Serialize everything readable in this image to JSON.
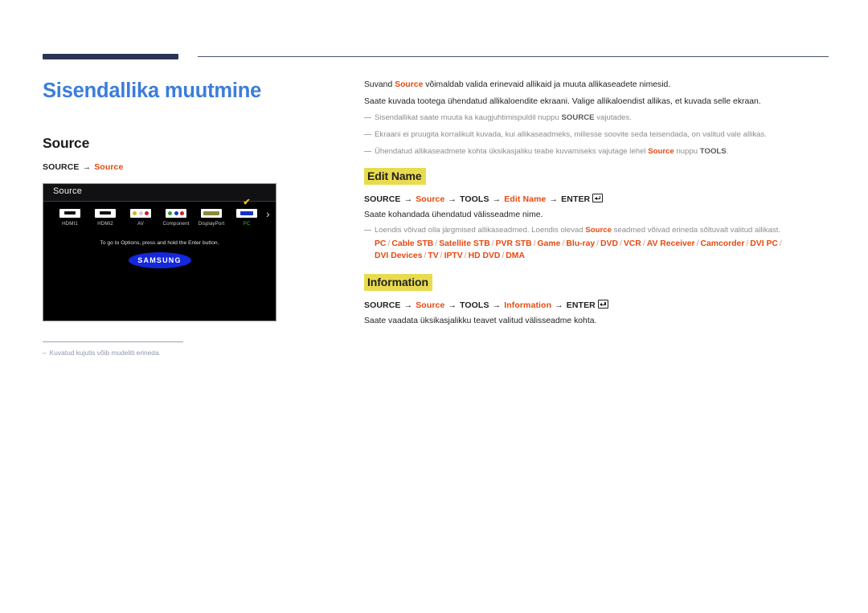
{
  "page": {
    "title": "Sisendallika muutmine",
    "title_color": "#3b7ddb",
    "accent_color": "#e8490f",
    "highlight_color": "#e8dc4e",
    "rule_color": "#2b3553"
  },
  "left": {
    "section_title": "Source",
    "path": {
      "root": "SOURCE",
      "arrow": "→",
      "target": "Source"
    },
    "tv": {
      "screen_title": "Source",
      "hint": "To go to Options, press and hold the Enter button.",
      "brand": "SAMSUNG",
      "next_arrow": "›",
      "check_mark": "✔",
      "sources": [
        {
          "label": "HDMI1",
          "icon": "hdmi-port-icon",
          "selected": false
        },
        {
          "label": "HDMI2",
          "icon": "hdmi-port-icon",
          "selected": false
        },
        {
          "label": "AV",
          "icon": "rca-composite-icon",
          "selected": false
        },
        {
          "label": "Component",
          "icon": "rca-component-icon",
          "selected": false
        },
        {
          "label": "DisplayPort",
          "icon": "displayport-icon",
          "selected": false
        },
        {
          "label": "PC",
          "icon": "vga-port-icon",
          "selected": true
        }
      ]
    },
    "footnote": {
      "dash": "–",
      "text": "Kuvatud kujutis võib mudeliti erineda."
    }
  },
  "right": {
    "intro": {
      "p1_a": "Suvand ",
      "p1_hl": "Source",
      "p1_b": " võimaldab valida erinevaid allikaid ja muuta allikaseadete nimesid.",
      "p2": "Saate kuvada tootega ühendatud allikaloendite ekraani. Valige allikaloendist allikas, et kuvada selle ekraan."
    },
    "intro_notes": [
      {
        "a": "Sisendallikat saate muuta ka kaugjuhtimispuldil nuppu ",
        "b": "SOURCE",
        "c": " vajutades."
      },
      {
        "a": "Ekraani ei pruugita korralikult kuvada, kui allikaseadmeks, millesse soovite seda teisendada, on valitud vale allikas.",
        "b": "",
        "c": ""
      },
      {
        "a": "Ühendatud allikaseadmete kohta üksikasjaliku teabe kuvamiseks vajutage lehel ",
        "b": "Source",
        "b_accent": true,
        "c": " nuppu ",
        "d": "TOOLS",
        "e": "."
      }
    ],
    "edit_name": {
      "heading": "Edit Name",
      "path": {
        "p1": "SOURCE",
        "p2": "Source",
        "p3": "TOOLS",
        "p4": "Edit Name",
        "p5": "ENTER",
        "arrow": "→"
      },
      "desc": "Saate kohandada ühendatud välisseadme nime.",
      "note": {
        "a": "Loendis võivad olla järgmised allikaseadmed. Loendis olevad ",
        "hl": "Source",
        "b": " seadmed võivad erineda sõltuvalt valitud allikast."
      },
      "devices_line1": [
        "PC",
        "Cable STB",
        "Satellite STB",
        "PVR STB",
        "Game",
        "Blu-ray",
        "DVD",
        "VCR",
        "AV Receiver",
        "Camcorder",
        "DVI PC"
      ],
      "devices_line2": [
        "DVI Devices",
        "TV",
        "IPTV",
        "HD DVD",
        "DMA"
      ],
      "separator": "/"
    },
    "information": {
      "heading": "Information",
      "path": {
        "p1": "SOURCE",
        "p2": "Source",
        "p3": "TOOLS",
        "p4": "Information",
        "p5": "ENTER",
        "arrow": "→"
      },
      "desc": "Saate vaadata üksikasjalikku teavet valitud välisseadme kohta."
    }
  }
}
